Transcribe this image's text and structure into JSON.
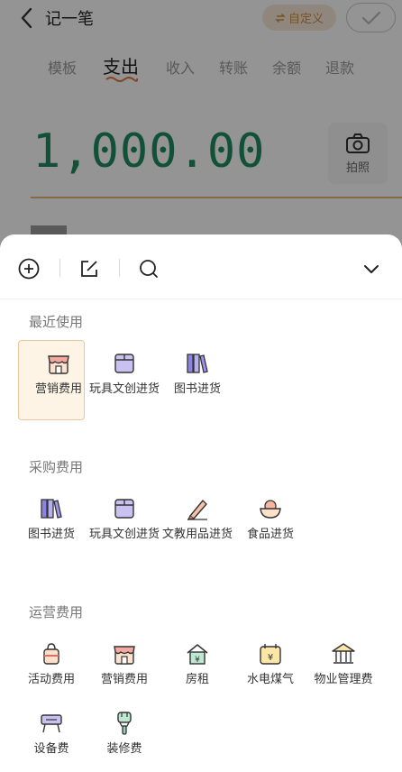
{
  "header": {
    "title": "记一笔",
    "custom_label": "自定义"
  },
  "tabs": [
    {
      "label": "模板"
    },
    {
      "label": "支出"
    },
    {
      "label": "收入"
    },
    {
      "label": "转账"
    },
    {
      "label": "余额"
    },
    {
      "label": "退款"
    }
  ],
  "active_tab": "支出",
  "amount": "1,000.00",
  "camera": {
    "label": "拍照"
  },
  "sheet": {
    "recent": {
      "title": "最近使用",
      "items": [
        {
          "label": "营销费用",
          "icon": "shop-icon"
        },
        {
          "label": "玩具文创进货",
          "icon": "toy-box-icon"
        },
        {
          "label": "图书进货",
          "icon": "books-icon"
        }
      ],
      "selected": "营销费用"
    },
    "purchase": {
      "title": "采购费用",
      "items": [
        {
          "label": "图书进货",
          "icon": "books-icon"
        },
        {
          "label": "玩具文创进货",
          "icon": "toy-box-icon"
        },
        {
          "label": "文教用品进货",
          "icon": "pen-icon"
        },
        {
          "label": "食品进货",
          "icon": "food-bowl-icon"
        }
      ]
    },
    "operation": {
      "title": "运营费用",
      "items": [
        {
          "label": "活动费用",
          "icon": "gift-bag-icon"
        },
        {
          "label": "营销费用",
          "icon": "shop-icon"
        },
        {
          "label": "房租",
          "icon": "house-yuan-icon"
        },
        {
          "label": "水电煤气",
          "icon": "utility-icon"
        },
        {
          "label": "物业管理费",
          "icon": "building-icon"
        },
        {
          "label": "设备费",
          "icon": "device-icon"
        },
        {
          "label": "装修费",
          "icon": "paint-brush-icon"
        }
      ]
    }
  },
  "colors": {
    "accent": "#1f8c5f",
    "highlight": "#e6b777",
    "custom_text": "#d08a3d"
  }
}
